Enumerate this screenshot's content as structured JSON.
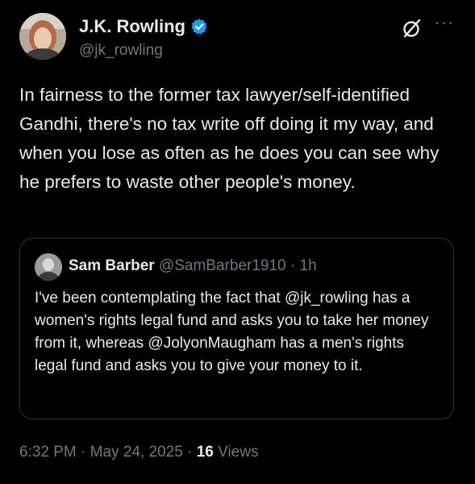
{
  "author": {
    "name": "J.K. Rowling",
    "handle": "@jk_rowling",
    "verified": true,
    "verified_color": "#1d9bf0"
  },
  "tweet": {
    "text": "In fairness to the former tax lawyer/self-identified Gandhi, there's no tax write off doing it my way, and when you lose as often as he does you can see why he prefers to waste other people's money."
  },
  "quoted": {
    "name": "Sam Barber",
    "handle": "@SamBarber1910",
    "separator": "·",
    "time": "1h",
    "text": "I've been contemplating the fact that @jk_rowling has a women's rights legal fund and asks you to take her money from it, whereas @JolyonMaugham has a men's rights legal fund and asks you to give your money to it."
  },
  "meta": {
    "time": "6:32 PM",
    "separator1": "·",
    "date": "May 24, 2025",
    "separator2": "·",
    "views_count": "16",
    "views_label": "Views"
  },
  "icons": {
    "grok": "grok-icon",
    "more": "more-icon",
    "verified": "verified-badge-icon"
  },
  "colors": {
    "background": "#000000",
    "text": "#e7e9ea",
    "muted": "#71767b",
    "border": "#2f3336"
  }
}
